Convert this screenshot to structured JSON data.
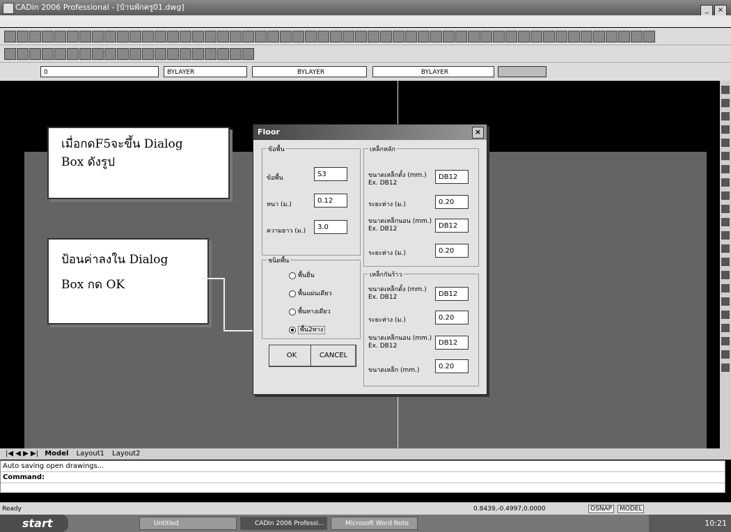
{
  "window": {
    "title": "CADin 2006 Professional - [บ้านพักครู01.dwg]"
  },
  "properties_toolbar": {
    "layer": "0",
    "color": "BYLAYER",
    "linetype": "BYLAYER",
    "lineweight": "BYLAYER"
  },
  "callouts": {
    "first": {
      "line1": "เมื่อกดF5จะขึ้น    Dialog",
      "line2": "Box ดังรูป"
    },
    "second": {
      "line1": "ป้อนค่าลงใน Dialog",
      "line2": "Box กด OK"
    }
  },
  "dialog": {
    "title": "Floor",
    "slab_group": {
      "label": "ข้อพื้น",
      "fields": [
        {
          "label": "ข้อพื้น",
          "value": "S3"
        },
        {
          "label": "หนา (ม.)",
          "value": "0.12"
        },
        {
          "label": "ความยาว (ม.)",
          "value": "3.0"
        }
      ]
    },
    "type_group": {
      "label": "ชนิดพื้น",
      "options": [
        "พื้นยื่น",
        "พื้นแผ่นเดียว",
        "พื้นทางเดียว",
        "พื้น2ทาง"
      ],
      "selected_index": 3
    },
    "main_steel_group": {
      "label": "เหล็กหลัก",
      "fields": [
        {
          "label": "ขนาดเหล็กตั้ง (mm.) Ex. DB12",
          "value": "DB12"
        },
        {
          "label": "ระยะห่าง (ม.)",
          "value": "0.20"
        },
        {
          "label": "ขนาดเหล็กนอน (mm.) Ex. DB12",
          "value": "DB12"
        },
        {
          "label": "ระยะห่าง (ม.)",
          "value": "0.20"
        }
      ]
    },
    "temp_steel_group": {
      "label": "เหล็กกันร้าว",
      "fields": [
        {
          "label": "ขนาดเหล็กตั้ง (mm.) Ex. DB12",
          "value": "DB12"
        },
        {
          "label": "ระยะห่าง (ม.)",
          "value": "0.20"
        },
        {
          "label": "ขนาดเหล็กนอน (mm.) Ex. DB12",
          "value": "DB12"
        },
        {
          "label": "ขนาดเหล็ก (mm.)",
          "value": "0.20"
        }
      ]
    },
    "ok_label": "OK",
    "cancel_label": "CANCEL"
  },
  "layout_tabs": [
    "Model",
    "Layout1",
    "Layout2"
  ],
  "command": {
    "history": "Auto saving open drawings...",
    "prompt": "Command:"
  },
  "status": {
    "ready": "Ready",
    "coords": "0.8439,-0.4997,0.0000",
    "toggles": [
      "OSNAP",
      "MODEL"
    ]
  },
  "taskbar": {
    "start": "start",
    "tasks": [
      "Untitled",
      "CADin 2006 Professi...",
      "Microsoft Word Note"
    ],
    "time": "10:21"
  }
}
